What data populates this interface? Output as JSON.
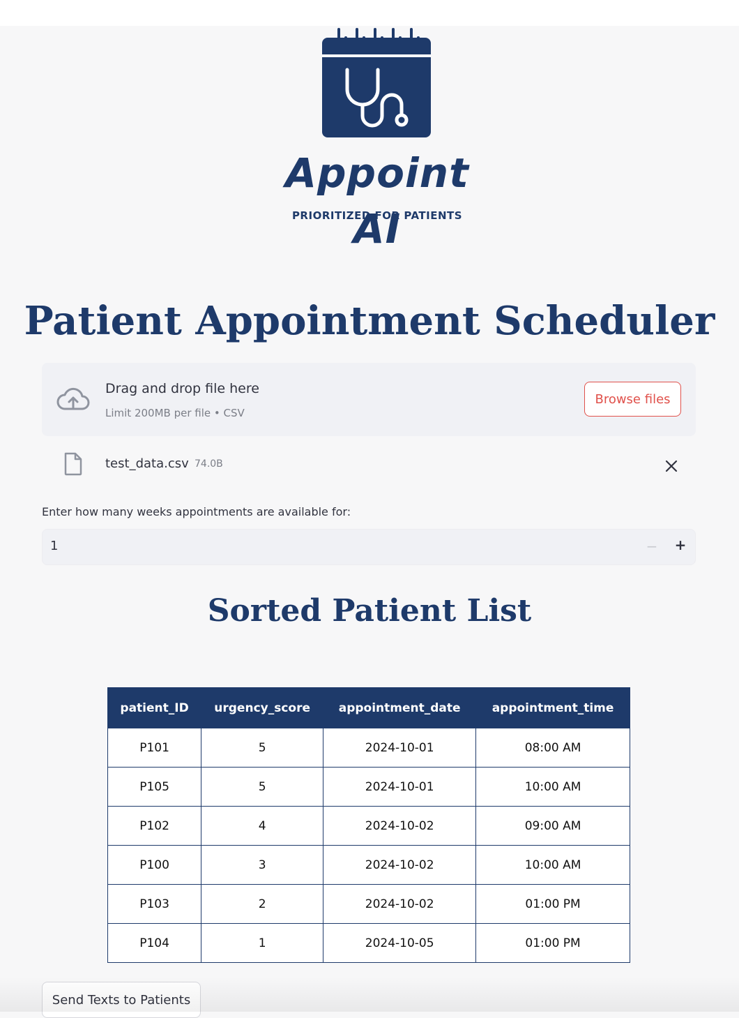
{
  "logo": {
    "word": "Appoint AI",
    "tagline": "PRIORITIZED FOR PATIENTS"
  },
  "page_title": "Patient Appointment Scheduler",
  "uploader": {
    "title": "Drag and drop file here",
    "limit": "Limit 200MB per file • CSV",
    "browse_label": "Browse files"
  },
  "file": {
    "name": "test_data.csv",
    "size": "74.0B"
  },
  "weeks": {
    "label": "Enter how many weeks appointments are available for:",
    "value": "1",
    "minus": "−",
    "plus": "+"
  },
  "sorted_title": "Sorted Patient List",
  "table": {
    "headers": [
      "patient_ID",
      "urgency_score",
      "appointment_date",
      "appointment_time"
    ],
    "rows": [
      [
        "P101",
        "5",
        "2024-10-01",
        "08:00 AM"
      ],
      [
        "P105",
        "5",
        "2024-10-01",
        "10:00 AM"
      ],
      [
        "P102",
        "4",
        "2024-10-02",
        "09:00 AM"
      ],
      [
        "P100",
        "3",
        "2024-10-02",
        "10:00 AM"
      ],
      [
        "P103",
        "2",
        "2024-10-02",
        "01:00 PM"
      ],
      [
        "P104",
        "1",
        "2024-10-05",
        "01:00 PM"
      ]
    ]
  },
  "send_button": "Send Texts to Patients",
  "colors": {
    "brand_navy": "#1e3a6a",
    "accent_red": "#e0514b",
    "background": "#f7f7f8"
  }
}
